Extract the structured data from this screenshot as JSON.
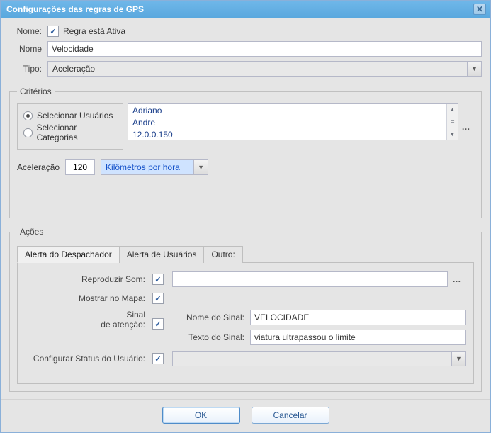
{
  "window": {
    "title": "Configurações das regras de GPS"
  },
  "header": {
    "name_label": "Nome:",
    "active_label": "Regra está Ativa",
    "active_checked": true,
    "name_field_label": "Nome",
    "name_value": "Velocidade",
    "type_label": "Tipo:",
    "type_value": "Aceleração"
  },
  "criteria": {
    "legend": "Critérios",
    "radio_users": "Selecionar Usuários",
    "radio_categories": "Selecionar Categorias",
    "radio_selected": "users",
    "list_items": [
      "Adriano",
      "Andre",
      "12.0.0.150"
    ],
    "accel_label": "Aceleração",
    "accel_value": "120",
    "unit_value": "Kilômetros por hora"
  },
  "actions": {
    "legend": "Ações",
    "tabs": [
      {
        "id": "dispatcher",
        "label": "Alerta do Despachador"
      },
      {
        "id": "users",
        "label": "Alerta de Usuários"
      },
      {
        "id": "other",
        "label": "Outro:"
      }
    ],
    "active_tab": "dispatcher",
    "play_sound_label": "Reproduzir Som:",
    "play_sound_checked": true,
    "play_sound_value": "",
    "show_map_label": "Mostrar no Mapa:",
    "show_map_checked": true,
    "signal_label_line1": "Sinal",
    "signal_label_line2": "de atenção:",
    "signal_checked": true,
    "signal_name_label": "Nome do Sinal:",
    "signal_name_value": "VELOCIDADE",
    "signal_text_label": "Texto do Sinal:",
    "signal_text_value": "viatura ultrapassou o limite",
    "user_status_label": "Configurar Status do Usuário:",
    "user_status_checked": true,
    "user_status_value": ""
  },
  "buttons": {
    "ok": "OK",
    "cancel": "Cancelar"
  }
}
